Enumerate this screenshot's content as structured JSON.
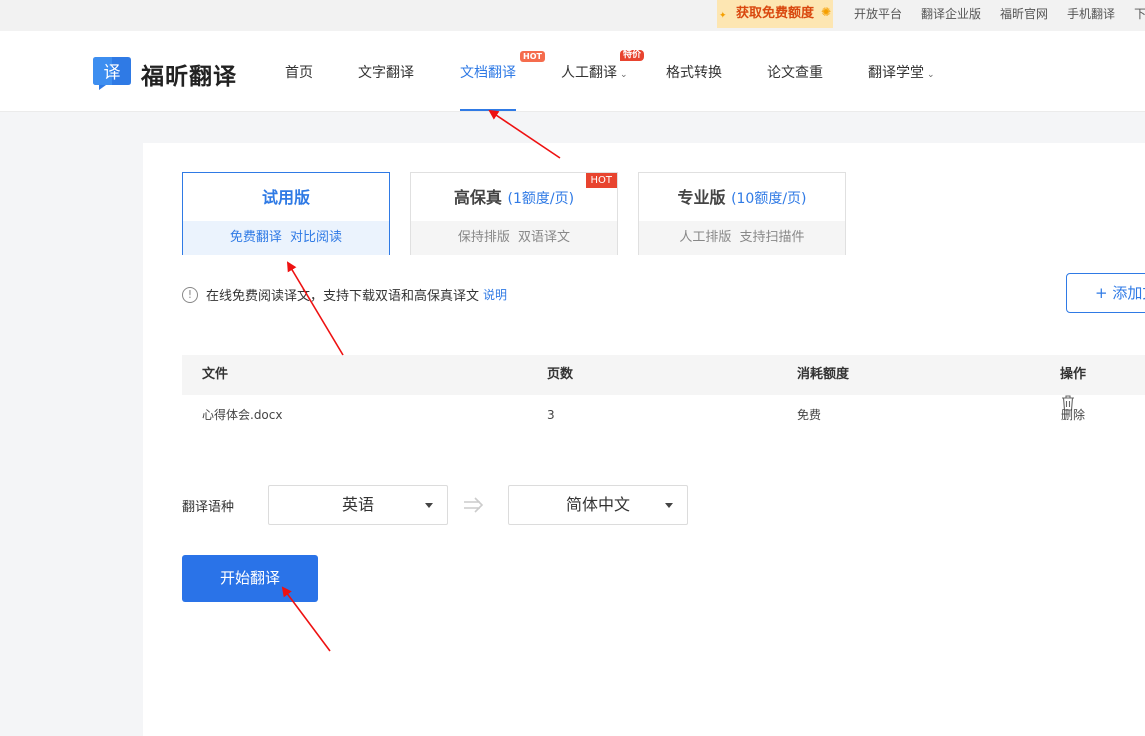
{
  "topbar": {
    "promo_label": "获取免费额度",
    "links": [
      "开放平台",
      "翻译企业版",
      "福昕官网",
      "手机翻译",
      "下"
    ]
  },
  "header": {
    "logo_glyph": "译",
    "logo_text": "福昕翻译",
    "nav": [
      {
        "label": "首页"
      },
      {
        "label": "文字翻译"
      },
      {
        "label": "文档翻译",
        "badge": "HOT",
        "active": true
      },
      {
        "label": "人工翻译",
        "badge": "特价",
        "has_caret": true
      },
      {
        "label": "格式转换"
      },
      {
        "label": "论文查重"
      },
      {
        "label": "翻译学堂",
        "has_caret": true
      }
    ]
  },
  "plans": [
    {
      "title": "试用版",
      "subtitle": "",
      "features": "免费翻译 对比阅读",
      "selected": true
    },
    {
      "title": "高保真",
      "subtitle": "(1额度/页)",
      "features": "保持排版 双语译文",
      "badge": "HOT"
    },
    {
      "title": "专业版",
      "subtitle": "(10额度/页)",
      "features": "人工排版 支持扫描件"
    }
  ],
  "info": {
    "icon": "info-circle-icon",
    "text": "在线免费阅读译文，支持下载双语和高保真译文",
    "link": "说明"
  },
  "add_button_label": "+ 添加文",
  "table": {
    "headers": [
      "文件",
      "页数",
      "消耗额度",
      "操作"
    ],
    "rows": [
      {
        "file": "心得体会.docx",
        "pages": "3",
        "cost": "免费",
        "action": "删除"
      }
    ]
  },
  "language": {
    "label": "翻译语种",
    "source": "英语",
    "target": "简体中文"
  },
  "start_button_label": "开始翻译",
  "colors": {
    "accent": "#2f7ae5",
    "primary_button": "#2a73e8",
    "hot_badge": "#e8442f",
    "annotation_arrow": "#e11"
  }
}
